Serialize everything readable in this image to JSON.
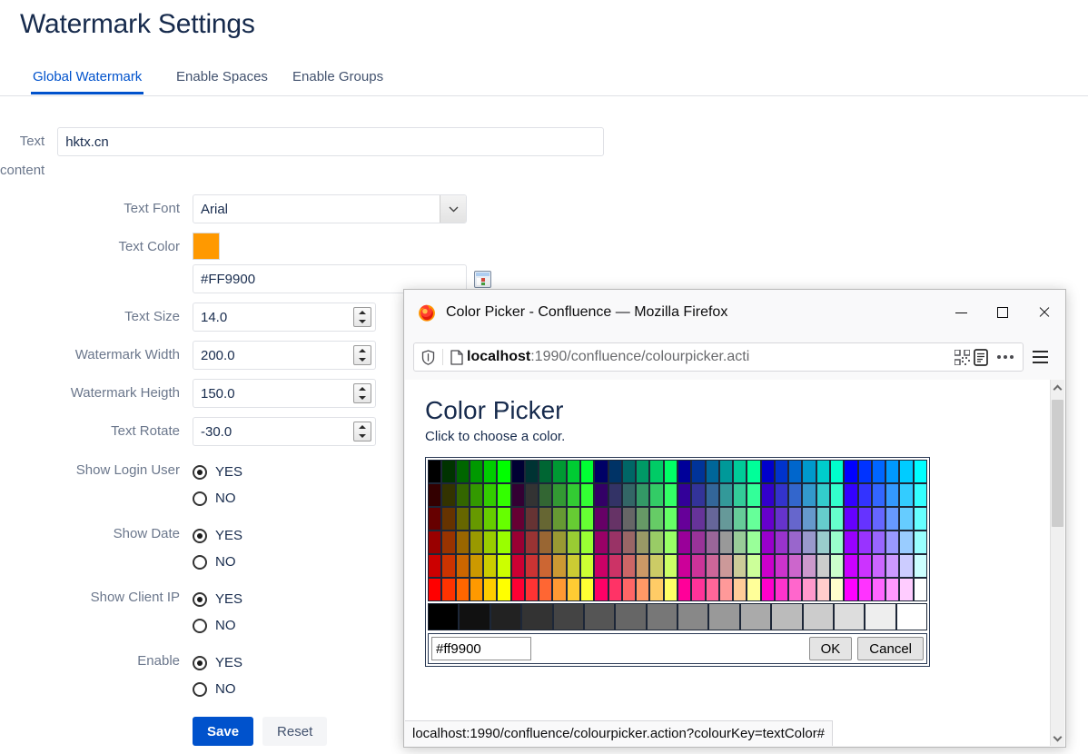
{
  "app": {
    "page_title": "Watermark Settings"
  },
  "tabs": [
    {
      "label": "Global Watermark",
      "active": true
    },
    {
      "label": "Enable Spaces",
      "active": false
    },
    {
      "label": "Enable Groups",
      "active": false
    }
  ],
  "form": {
    "text_content": {
      "label": "Text content",
      "value": "hktx.cn",
      "placeholder": ""
    },
    "text_font": {
      "label": "Text Font",
      "value": "Arial",
      "options": [
        "Arial"
      ]
    },
    "text_color": {
      "label": "Text Color",
      "value": "#FF9900",
      "swatch_color": "#FF9900"
    },
    "text_size": {
      "label": "Text Size",
      "value": "14.0"
    },
    "watermark_width": {
      "label": "Watermark Width",
      "value": "200.0"
    },
    "watermark_height": {
      "label": "Watermark Heigth",
      "value": "150.0"
    },
    "text_rotate": {
      "label": "Text Rotate",
      "value": "-30.0"
    },
    "show_login_user": {
      "label": "Show Login User",
      "yes": "YES",
      "no": "NO",
      "selected": "YES"
    },
    "show_date": {
      "label": "Show Date",
      "yes": "YES",
      "no": "NO",
      "selected": "YES"
    },
    "show_client_ip": {
      "label": "Show Client IP",
      "yes": "YES",
      "no": "NO",
      "selected": "YES"
    },
    "enable": {
      "label": "Enable",
      "yes": "YES",
      "no": "NO",
      "selected": "YES"
    },
    "save_label": "Save",
    "reset_label": "Reset",
    "accent_color": "#0052cc"
  },
  "firefox_window": {
    "title": "Color Picker - Confluence — Mozilla Firefox",
    "window_controls": {
      "minimize": "minimize-icon",
      "maximize": "maximize-icon",
      "close": "close-icon"
    },
    "urlbar": {
      "host": "localhost",
      "path": ":1990/confluence/colourpicker.acti",
      "full": "localhost:1990/confluence/colourpicker.acti",
      "icons": [
        "shield-icon",
        "page-document-icon",
        "qr-code-icon",
        "reader-mode-icon",
        "page-actions-icon"
      ]
    },
    "menu_icon": "hamburger-menu-icon",
    "page": {
      "heading": "Color Picker",
      "subheading": "Click to choose a color.",
      "hex_value": "#ff9900",
      "ok_label": "OK",
      "cancel_label": "Cancel"
    },
    "statusbar": "localhost:1990/confluence/colourpicker.action?colourKey=textColor#"
  },
  "palette": {
    "columns": 36,
    "rows": 6,
    "gray_columns": 16,
    "red_levels": [
      "00",
      "33",
      "66",
      "99",
      "CC",
      "FF"
    ],
    "green_levels": [
      "00",
      "33",
      "66",
      "99",
      "CC",
      "FF"
    ],
    "blue_levels": [
      "00",
      "33",
      "66",
      "99",
      "CC",
      "FF"
    ],
    "grays": [
      "#000000",
      "#111111",
      "#222222",
      "#333333",
      "#444444",
      "#555555",
      "#666666",
      "#777777",
      "#888888",
      "#999999",
      "#AAAAAA",
      "#BBBBBB",
      "#CCCCCC",
      "#DDDDDD",
      "#EEEEEE",
      "#FFFFFF"
    ]
  }
}
